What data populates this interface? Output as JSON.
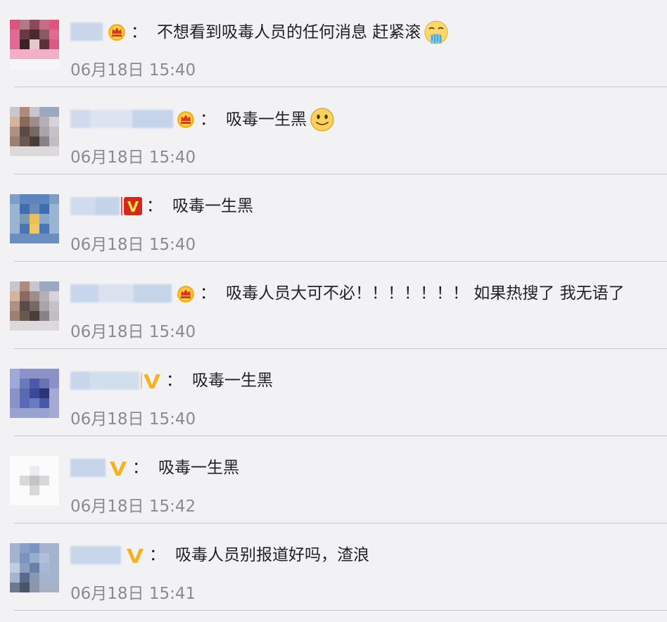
{
  "comments": [
    {
      "text": "不想看到吸毒人员的任何消息 赶紧滚",
      "time": "06月18日 15:40",
      "badge": "crown-icon",
      "emoji": "puke-face-emoji"
    },
    {
      "text": "吸毒一生黑",
      "time": "06月18日 15:40",
      "badge": "crown-icon",
      "emoji": "smile-face-emoji"
    },
    {
      "text": "吸毒一生黑",
      "time": "06月18日 15:40",
      "badge": "red-v-icon",
      "emoji": ""
    },
    {
      "text": "吸毒人员大可不必！！！！！！！ 如果热搜了 我无语了",
      "time": "06月18日 15:40",
      "badge": "crown-icon",
      "emoji": ""
    },
    {
      "text": "吸毒一生黑",
      "time": "06月18日 15:40",
      "badge": "yellow-v-icon",
      "emoji": ""
    },
    {
      "text": "吸毒一生黑",
      "time": "06月18日 15:42",
      "badge": "yellow-v-icon",
      "emoji": ""
    },
    {
      "text": "吸毒人员别报道好吗，渣浪",
      "time": "06月18日 15:41",
      "badge": "yellow-v-icon",
      "emoji": ""
    }
  ],
  "colon": "："
}
